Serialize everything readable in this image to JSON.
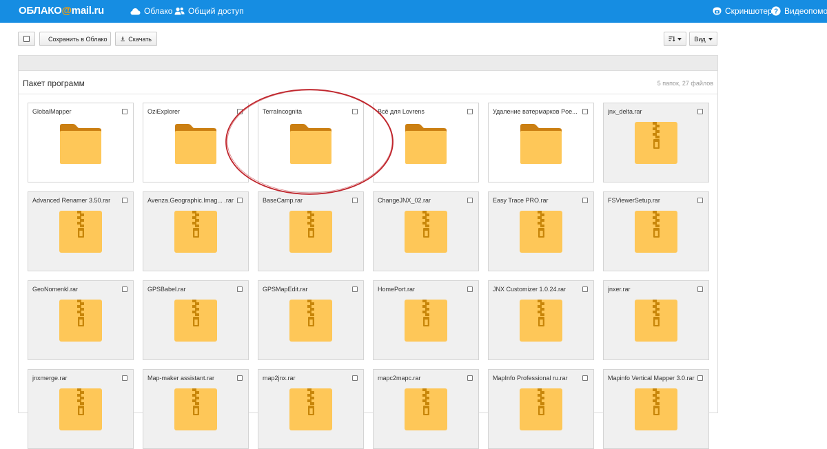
{
  "header": {
    "logo_main": "ОБЛАКО",
    "logo_at": "@",
    "logo_domain": "mail.ru",
    "nav_cloud": "Облако",
    "nav_share": "Общий доступ",
    "nav_screenshot": "Скриншотер",
    "nav_help": "Видеопомощь"
  },
  "toolbar": {
    "save_label": "Сохранить в Облако",
    "download_label": "Скачать",
    "view_label": "Вид"
  },
  "panel": {
    "title": "Пакет программ",
    "count": "5 папок, 27 файлов"
  },
  "items": [
    {
      "name": "GlobalMapper",
      "type": "folder"
    },
    {
      "name": "OziExplorer",
      "type": "folder"
    },
    {
      "name": "TerraIncognita",
      "type": "folder"
    },
    {
      "name": "Всё для Lovrens",
      "type": "folder"
    },
    {
      "name": "Удаление ватермарков Poe...",
      "type": "folder"
    },
    {
      "name": "jnx_delta.rar",
      "type": "archive"
    },
    {
      "name": "Advanced Renamer 3.50.rar",
      "type": "archive"
    },
    {
      "name": "Avenza.Geographic.Imag... .rar",
      "type": "archive"
    },
    {
      "name": "BaseCamp.rar",
      "type": "archive"
    },
    {
      "name": "ChangeJNX_02.rar",
      "type": "archive"
    },
    {
      "name": "Easy Trace PRO.rar",
      "type": "archive"
    },
    {
      "name": "FSViewerSetup.rar",
      "type": "archive"
    },
    {
      "name": "GeoNomenkl.rar",
      "type": "archive"
    },
    {
      "name": "GPSBabel.rar",
      "type": "archive"
    },
    {
      "name": "GPSMapEdit.rar",
      "type": "archive"
    },
    {
      "name": "HomePort.rar",
      "type": "archive"
    },
    {
      "name": "JNX Customizer 1.0.24.rar",
      "type": "archive"
    },
    {
      "name": "jnxer.rar",
      "type": "archive"
    },
    {
      "name": "jnxmerge.rar",
      "type": "archive"
    },
    {
      "name": "Map-maker assistant.rar",
      "type": "archive"
    },
    {
      "name": "map2jnx.rar",
      "type": "archive"
    },
    {
      "name": "mapc2mapc.rar",
      "type": "archive"
    },
    {
      "name": "MapInfo Professional ru.rar",
      "type": "archive"
    },
    {
      "name": "Mapinfo Vertical Mapper 3.0.rar",
      "type": "archive"
    }
  ],
  "colors": {
    "header_bg": "#168de2",
    "logo_accent": "#ff9e00",
    "folder_body": "#fec758",
    "folder_tab": "#cb7f12",
    "archive_body": "#fec758",
    "archive_zipper": "#c8860a",
    "annotation": "#c0262d"
  }
}
